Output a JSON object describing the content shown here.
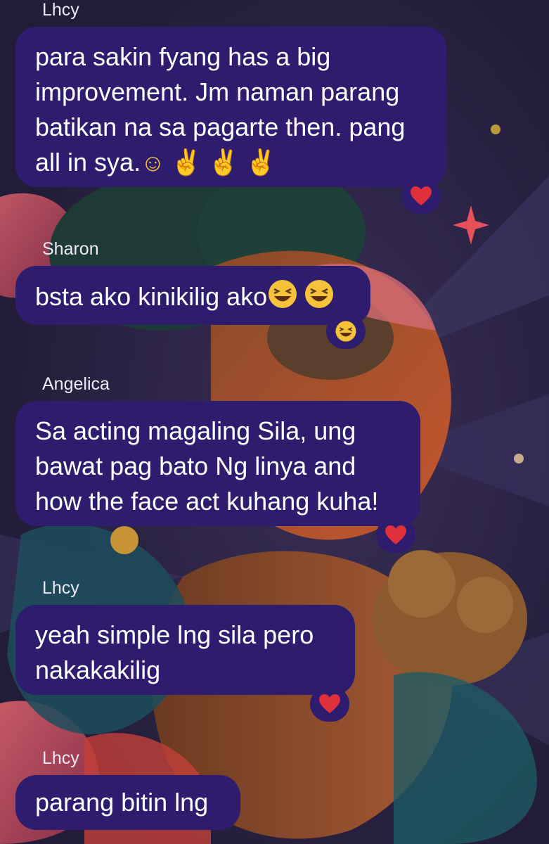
{
  "messages": [
    {
      "sender": "Lhcy",
      "text": "para sakin fyang has a big improvement. Jm naman parang batikan na sa pagarte then. pang all in sya.☺️✌🏻✌🏻✌🏻",
      "reaction": "red-heart-icon"
    },
    {
      "sender": "Sharon",
      "text": "bsta ako kinikilig ako😆😆",
      "reaction": "grinning-squinting-face-icon"
    },
    {
      "sender": "Angelica",
      "text": "Sa acting magaling Sila, ung bawat pag bato Ng linya and how the face act kuhang kuha!",
      "reaction": "red-heart-icon"
    },
    {
      "sender": "Lhcy",
      "text": "yeah simple lng sila pero nakakakilig",
      "reaction": "red-heart-icon"
    },
    {
      "sender": "Lhcy",
      "text": "parang bitin lng",
      "reaction": null
    }
  ],
  "texts": {
    "m1_line1": "para sakin fyang has a big",
    "m1_line2": "improvement. Jm naman parang",
    "m1_line3": "batikan na sa pagarte then. pang",
    "m1_line4a": "all in sya.",
    "m1_emoji_smile": "☺",
    "m1_emoji_peace": "✌",
    "m2_text": "bsta ako kinikilig ako",
    "m3_line1": "Sa acting magaling Sila, ung",
    "m3_line2": "bawat pag bato Ng linya and",
    "m3_line3": "how the face act kuhang kuha!",
    "m4_line1": "yeah simple lng sila pero",
    "m4_line2": "nakakakilig",
    "m5_text": "parang bitin lng"
  },
  "colors": {
    "bubble": "#2e1d6e",
    "background": "#2a2344",
    "text": "#ffffff",
    "sender": "#ece9f5",
    "heart": "#e0303c",
    "emoji": "#f6c23a"
  }
}
